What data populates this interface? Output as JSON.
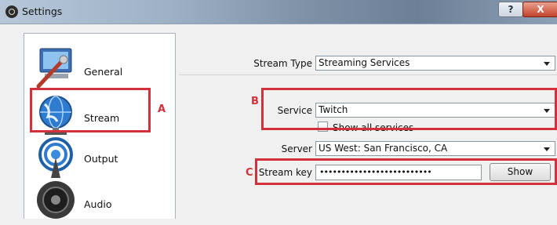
{
  "window": {
    "title": "Settings",
    "help_label": "?",
    "close_label": "X"
  },
  "sidebar": {
    "items": [
      {
        "label": "General",
        "icon": "general-icon"
      },
      {
        "label": "Stream",
        "icon": "stream-globe-icon"
      },
      {
        "label": "Output",
        "icon": "output-broadcast-icon"
      },
      {
        "label": "Audio",
        "icon": "audio-speaker-icon"
      }
    ]
  },
  "stream": {
    "stream_type_label": "Stream Type",
    "stream_type_value": "Streaming Services",
    "service_label": "Service",
    "service_value": "Twitch",
    "show_all_label": "Show all services",
    "show_all_checked": false,
    "server_label": "Server",
    "server_value": "US West: San Francisco, CA",
    "key_label": "Stream key",
    "key_value": "••••••••••••••••••••••••••",
    "show_button": "Show"
  },
  "annotations": {
    "a": "A",
    "b": "B",
    "c": "C"
  },
  "colors": {
    "annotation_red": "#d3303b",
    "titlebar": "#7e91a7"
  }
}
